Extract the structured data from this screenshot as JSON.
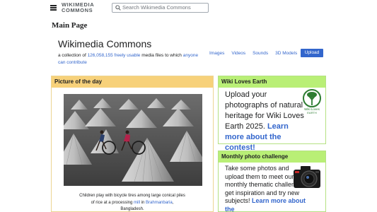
{
  "header": {
    "logo_line1": "WIKIMEDIA",
    "logo_line2": "COMMONS",
    "search_placeholder": "Search Wikimedia Commons"
  },
  "page_title": "Main Page",
  "intro": {
    "site_name": "Wikimedia Commons",
    "tagline_prefix": "a collection of ",
    "file_count": "126,058,155",
    "tagline_free": "freely usable",
    "tagline_mid": " media files to which ",
    "tagline_anyone": "anyone",
    "tagline_contribute": "can contribute"
  },
  "media_nav": {
    "images": "Images",
    "videos": "Videos",
    "sounds": "Sounds",
    "models": "3D Models",
    "upload": "Upload"
  },
  "potd": {
    "heading": "Picture of the day",
    "caption_line1": "Children play with bicycle tires among large conical piles",
    "caption_line2_prefix": "of rice at a processing ",
    "caption_mill": "mill",
    "caption_in": " in ",
    "caption_place": "Brahmanbaria",
    "caption_comma": ",",
    "caption_line3": "Bangladesh."
  },
  "wle": {
    "heading": "Wiki Loves Earth",
    "text": "Upload your photographs of natural heritage for Wiki Loves Earth 2025. ",
    "link": "Learn more about the contest!",
    "logo_text1": "Wiki Loves",
    "logo_text2": "EARTH"
  },
  "mpc": {
    "heading": "Monthly photo challenge",
    "text": "Take some photos and upload them to meet our monthly thematic challenge, get inspiration and try new subjects! ",
    "link": "Learn more about the"
  },
  "colors": {
    "link": "#3366cc",
    "potd_header": "#f7d17a",
    "box_header": "#b9ef76",
    "upload_button": "#3366cc"
  },
  "icons": [
    "hamburger-menu-icon",
    "search-icon",
    "wiki-loves-earth-logo",
    "camera-icon"
  ]
}
